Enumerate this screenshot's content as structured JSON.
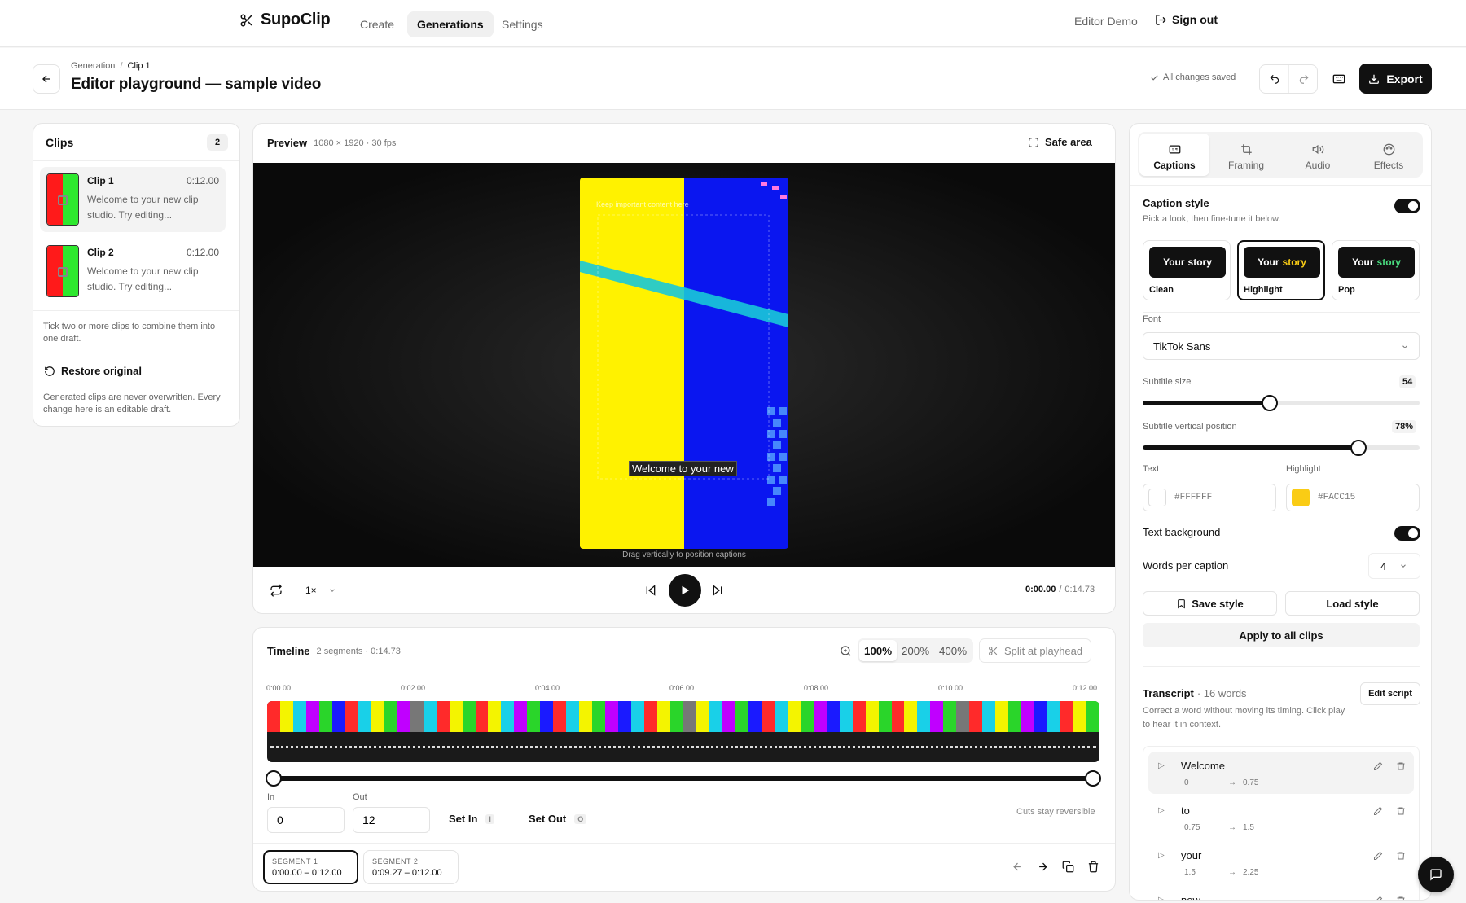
{
  "nav": {
    "brand": "SupoClip",
    "links": [
      "Create",
      "Generations",
      "Settings"
    ],
    "active": "Generations",
    "user": "Editor Demo",
    "signout": "Sign out"
  },
  "header": {
    "crumbs": [
      "Generation",
      "Clip 1"
    ],
    "crumb_sep": "/",
    "title": "Editor playground — sample video",
    "saved": "All changes saved",
    "export": "Export"
  },
  "clips_panel": {
    "title": "Clips",
    "count": "2",
    "clips": [
      {
        "name": "Clip 1",
        "time": "0:12.00",
        "desc": "Welcome to your new clip studio. Try editing..."
      },
      {
        "name": "Clip 2",
        "time": "0:12.00",
        "desc": "Welcome to your new clip studio. Try editing..."
      }
    ],
    "hint": "Tick two or more clips to combine them into one draft.",
    "restore": "Restore original",
    "note": "Generated clips are never overwritten. Every change here is an editable draft."
  },
  "preview": {
    "title": "Preview",
    "meta": "1080 × 1920 · 30 fps",
    "safe_area": "Safe area",
    "keep_text": "Keep important content here",
    "caption": "Welcome to your new",
    "drag_hint": "Drag vertically to position captions",
    "speed": "1×",
    "time_current": "0:00.00",
    "time_sep": "/",
    "time_total": "0:14.73"
  },
  "timeline": {
    "title": "Timeline",
    "meta": "2 segments · 0:14.73",
    "zooms": [
      "100%",
      "200%",
      "400%"
    ],
    "zoom_active": "100%",
    "split": "Split at playhead",
    "ticks": [
      "0:00.00",
      "0:02.00",
      "0:04.00",
      "0:06.00",
      "0:08.00",
      "0:10.00",
      "0:12.00"
    ],
    "in_label": "In",
    "out_label": "Out",
    "in_value": "0",
    "out_value": "12",
    "set_in": "Set In",
    "set_in_key": "I",
    "set_out": "Set Out",
    "set_out_key": "O",
    "reversible": "Cuts stay reversible",
    "segments": [
      {
        "label": "SEGMENT 1",
        "range": "0:00.00 – 0:12.00"
      },
      {
        "label": "SEGMENT 2",
        "range": "0:09.27 – 0:12.00"
      }
    ],
    "trim_range": [
      0,
      1
    ]
  },
  "right_panel": {
    "tabs": [
      "Captions",
      "Framing",
      "Audio",
      "Effects"
    ],
    "active_tab": "Captions",
    "caption_style": {
      "title": "Caption style",
      "sub": "Pick a look, then fine-tune it below.",
      "presets": [
        {
          "name": "Clean",
          "lead": "Your",
          "word": "story",
          "word_color": "#FFFFFF"
        },
        {
          "name": "Highlight",
          "lead": "Your",
          "word": "story",
          "word_color": "#FACC15"
        },
        {
          "name": "Pop",
          "lead": "Your",
          "word": "story",
          "word_color": "#4ADE80"
        }
      ],
      "selected": "Highlight"
    },
    "font_label": "Font",
    "font_value": "TikTok Sans",
    "size_label": "Subtitle size",
    "size_value": "54",
    "size_fraction": 0.46,
    "vpos_label": "Subtitle vertical position",
    "vpos_value": "78%",
    "vpos_fraction": 0.78,
    "text_label": "Text",
    "text_color": "#FFFFFF",
    "highlight_label": "Highlight",
    "highlight_color": "#FACC15",
    "text_bg_label": "Text background",
    "text_bg_on": true,
    "wpc_label": "Words per caption",
    "wpc_value": "4",
    "save_style": "Save style",
    "load_style": "Load style",
    "apply_all": "Apply to all clips",
    "transcript": {
      "title": "Transcript",
      "count": "· 16 words",
      "edit": "Edit script",
      "desc": "Correct a word without moving its timing. Click play to hear it in context.",
      "words": [
        {
          "word": "Welcome",
          "start": "0",
          "end": "0.75"
        },
        {
          "word": "to",
          "start": "0.75",
          "end": "1.5"
        },
        {
          "word": "your",
          "start": "1.5",
          "end": "2.25"
        },
        {
          "word": "new",
          "start": "",
          "end": ""
        }
      ]
    }
  },
  "colors": {
    "accent": "#111111",
    "highlight": "#FACC15",
    "video_yellow": "#FFF200",
    "video_blue": "#0A16F0"
  }
}
